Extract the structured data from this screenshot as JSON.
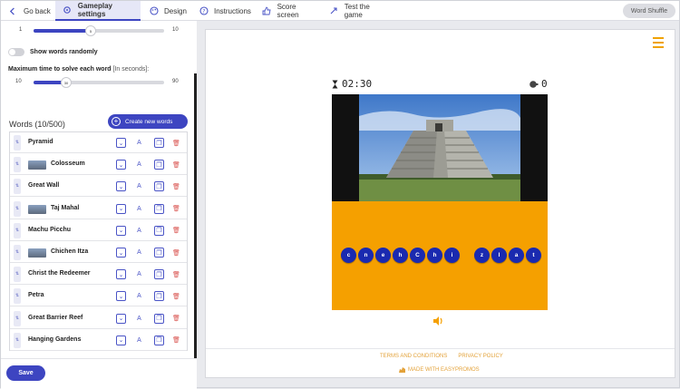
{
  "nav": {
    "items": [
      {
        "label": "Go back",
        "icon": "arrow-left-icon"
      },
      {
        "label": "Gameplay settings",
        "icon": "gear-icon",
        "active": true
      },
      {
        "label": "Design",
        "icon": "palette-icon"
      },
      {
        "label": "Instructions",
        "icon": "question-icon"
      },
      {
        "label": "Score screen",
        "icon": "thumbs-up-icon"
      },
      {
        "label": "Test the game",
        "icon": "rocket-icon"
      }
    ],
    "game_name": "Word Shuffle"
  },
  "settings": {
    "slider1": {
      "min": "1",
      "max": "10",
      "value": "5"
    },
    "random_label": "Show words randomly",
    "random_on": false,
    "max_time_label": "Maximum time to solve each word",
    "max_time_unit": "[In seconds]:",
    "slider2": {
      "min": "10",
      "max": "90",
      "value": "30"
    }
  },
  "words": {
    "heading": "Words (10/500)",
    "create_label": "Create new words",
    "items": [
      {
        "label": "Pyramid",
        "thumb": false
      },
      {
        "label": "Colosseum",
        "thumb": true
      },
      {
        "label": "Great Wall",
        "thumb": false
      },
      {
        "label": "Taj Mahal",
        "thumb": true
      },
      {
        "label": "Machu Picchu",
        "thumb": false
      },
      {
        "label": "Chichen Itza",
        "thumb": true
      },
      {
        "label": "Christ the Redeemer",
        "thumb": false
      },
      {
        "label": "Petra",
        "thumb": false
      },
      {
        "label": "Great Barrier Reef",
        "thumb": false
      },
      {
        "label": "Hanging Gardens",
        "thumb": false
      }
    ]
  },
  "save_label": "Save",
  "preview": {
    "timer": "02:30",
    "score": "0",
    "letters_word1": [
      "c",
      "n",
      "e",
      "h",
      "C",
      "h",
      "i"
    ],
    "letters_word2": [
      "z",
      "I",
      "a",
      "t"
    ],
    "footer_terms": "TERMS AND CONDITIONS",
    "footer_privacy": "PRIVACY POLICY",
    "footer_made": "MADE WITH EASYPROMOS"
  },
  "colors": {
    "accent": "#3d45c1",
    "stage": "#f5a000",
    "tile": "#1a2ab0"
  }
}
